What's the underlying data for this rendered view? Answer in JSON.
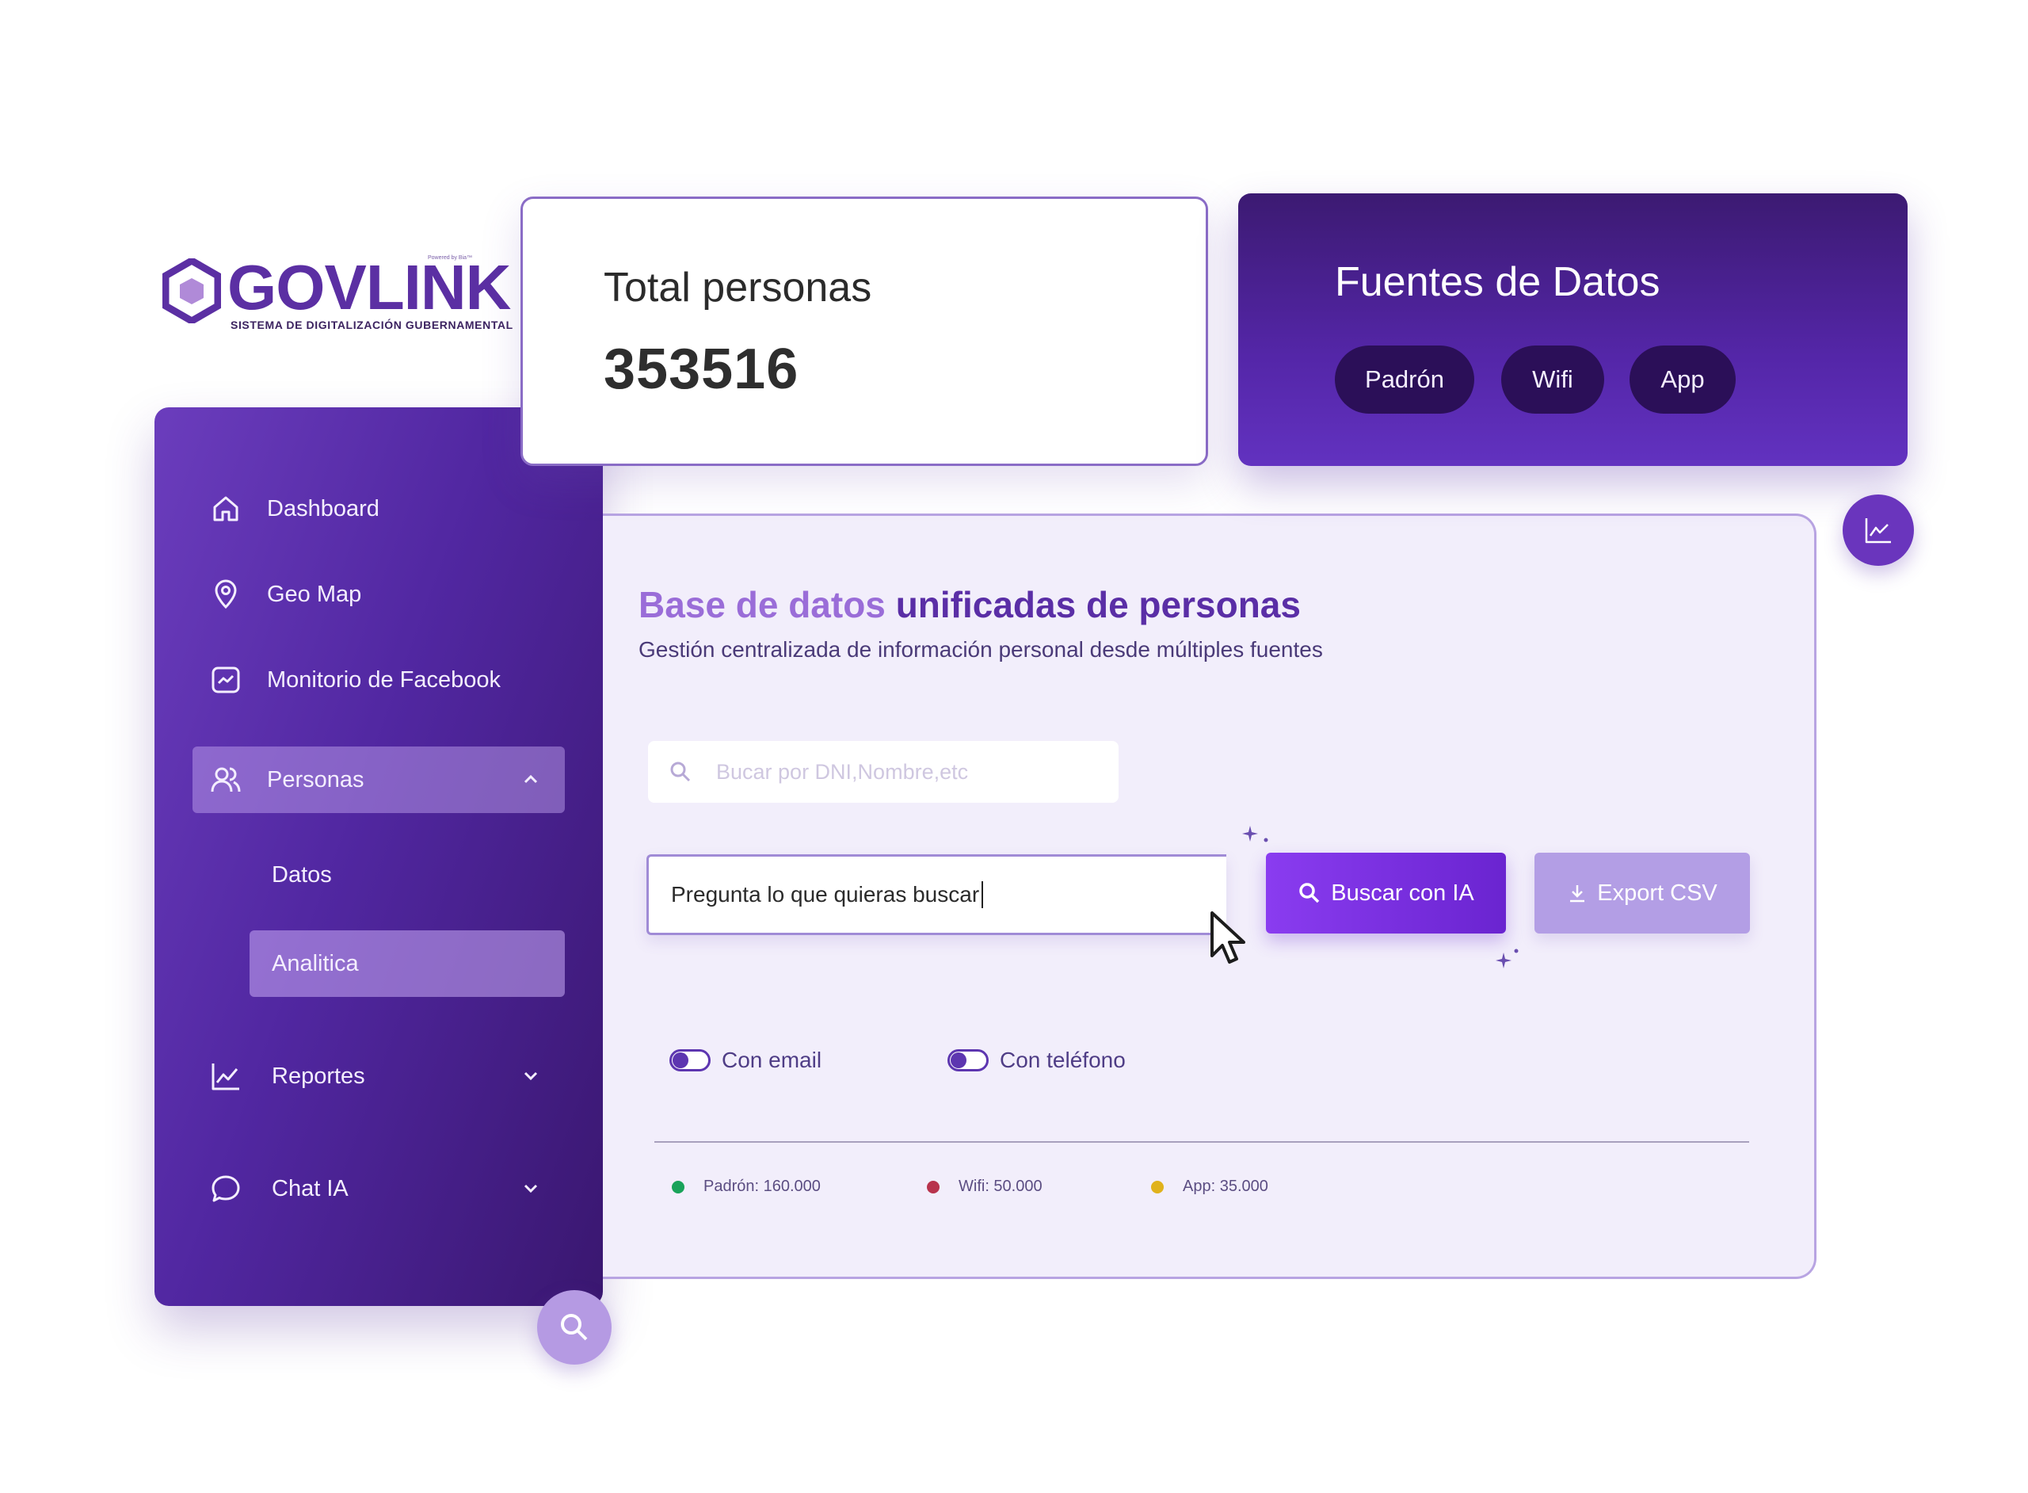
{
  "logo": {
    "name": "GOVLINK",
    "tagline": "SISTEMA DE DIGITALIZACIÓN GUBERNAMENTAL",
    "powered": "Powered by Bia™",
    "brand_color": "#5b2fa3"
  },
  "sidebar": {
    "items": [
      {
        "label": "Dashboard",
        "icon": "home-icon"
      },
      {
        "label": "Geo Map",
        "icon": "map-pin-icon"
      },
      {
        "label": "Monitorio de Facebook",
        "icon": "trend-box-icon"
      },
      {
        "label": "Personas",
        "icon": "users-icon",
        "expanded": true
      },
      {
        "label": "Reportes",
        "icon": "line-chart-icon"
      },
      {
        "label": "Chat IA",
        "icon": "chat-bubble-icon"
      }
    ],
    "sub_items": [
      {
        "label": "Datos"
      },
      {
        "label": "Analitica",
        "active": true
      }
    ]
  },
  "total_card": {
    "title": "Total personas",
    "value": "353516"
  },
  "sources_card": {
    "title": "Fuentes de Datos",
    "pills": [
      "Padrón",
      "Wifi",
      "App"
    ]
  },
  "main": {
    "heading_light": "Base de datos",
    "heading_dark": "unificadas de personas",
    "subheading": "Gestión centralizada de información personal desde múltiples fuentes",
    "search_placeholder": "Bucar por DNI,Nombre,etc",
    "ai_prompt": "Pregunta lo que quieras buscar",
    "ai_button": "Buscar con IA",
    "csv_button": "Export CSV",
    "toggles": [
      "Con email",
      "Con teléfono"
    ],
    "legend": [
      {
        "label": "Padrón: 160.000",
        "color": "#1aa35a"
      },
      {
        "label": "Wifi: 50.000",
        "color": "#b8334d"
      },
      {
        "label": "App: 35.000",
        "color": "#e0b21c"
      }
    ]
  },
  "colors": {
    "accent": "#7b34e6",
    "sidebar": "#5127a1",
    "panel_bg": "#f2eefb"
  }
}
